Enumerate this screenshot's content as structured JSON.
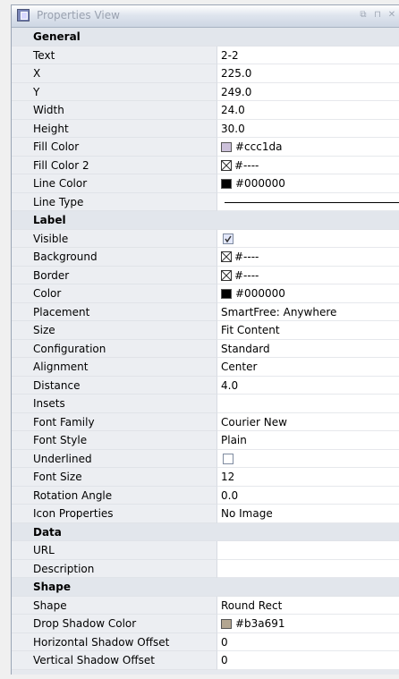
{
  "panel": {
    "title": "Properties View",
    "controls": [
      "restore-icon",
      "pin-icon",
      "close-icon"
    ],
    "restore_glyph": "⧉",
    "pin_glyph": "⊓",
    "close_glyph": "✕"
  },
  "sections": {
    "general": {
      "title": "General",
      "text": {
        "label": "Text",
        "value": "2-2"
      },
      "x": {
        "label": "X",
        "value": "225.0"
      },
      "y": {
        "label": "Y",
        "value": "249.0"
      },
      "width": {
        "label": "Width",
        "value": "24.0"
      },
      "height": {
        "label": "Height",
        "value": "30.0"
      },
      "fill_color": {
        "label": "Fill Color",
        "value": "#ccc1da",
        "swatch": "#ccc1da"
      },
      "fill_color_2": {
        "label": "Fill Color 2",
        "value": "#----"
      },
      "line_color": {
        "label": "Line Color",
        "value": "#000000",
        "swatch": "#000000"
      },
      "line_type": {
        "label": "Line Type"
      }
    },
    "label": {
      "title": "Label",
      "visible": {
        "label": "Visible",
        "checked": true
      },
      "background": {
        "label": "Background",
        "value": "#----"
      },
      "border": {
        "label": "Border",
        "value": "#----"
      },
      "color": {
        "label": "Color",
        "value": "#000000",
        "swatch": "#000000"
      },
      "placement": {
        "label": "Placement",
        "value": "SmartFree: Anywhere"
      },
      "size": {
        "label": "Size",
        "value": "Fit Content"
      },
      "configuration": {
        "label": "Configuration",
        "value": "Standard"
      },
      "alignment": {
        "label": "Alignment",
        "value": "Center"
      },
      "distance": {
        "label": "Distance",
        "value": "4.0"
      },
      "insets": {
        "label": "Insets",
        "value": ""
      },
      "font_family": {
        "label": "Font Family",
        "value": "Courier New"
      },
      "font_style": {
        "label": "Font Style",
        "value": "Plain"
      },
      "underlined": {
        "label": "Underlined",
        "checked": false
      },
      "font_size": {
        "label": "Font Size",
        "value": "12"
      },
      "rotation_angle": {
        "label": "Rotation Angle",
        "value": "0.0"
      },
      "icon_properties": {
        "label": "Icon Properties",
        "value": "No Image"
      }
    },
    "data": {
      "title": "Data",
      "url": {
        "label": "URL",
        "value": ""
      },
      "description": {
        "label": "Description",
        "value": ""
      }
    },
    "shape": {
      "title": "Shape",
      "shape": {
        "label": "Shape",
        "value": "Round Rect"
      },
      "drop_shadow_color": {
        "label": "Drop Shadow Color",
        "value": "#b3a691",
        "swatch": "#b3a691"
      },
      "h_shadow_offset": {
        "label": "Horizontal Shadow Offset",
        "value": "0"
      },
      "v_shadow_offset": {
        "label": "Vertical Shadow Offset",
        "value": "0"
      }
    }
  }
}
